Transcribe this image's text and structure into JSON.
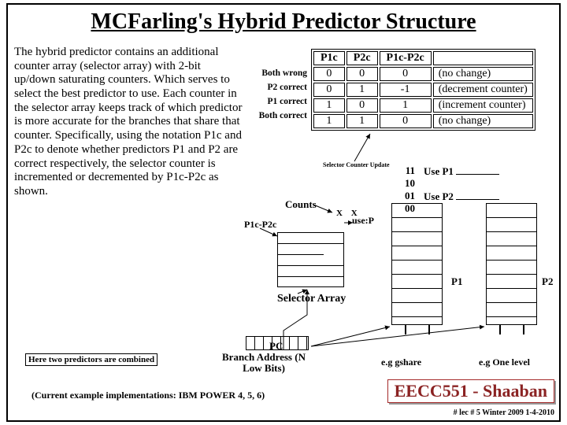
{
  "title": "MCFarling's Hybrid Predictor Structure",
  "body": "The hybrid predictor contains an additional counter array (selector array) with 2-bit up/down saturating counters. Which serves to select the best predictor to use. Each counter in the selector array keeps track of which predictor is more accurate for the branches that share that counter. Specifically, using the notation P1c and P2c to denote whether predictors P1 and P2 are correct respectively, the selector counter is incremented or decremented by P1c-P2c as shown.",
  "row_labels": [
    "Both wrong",
    "P2 correct",
    "P1 correct",
    "Both correct"
  ],
  "table": {
    "headers": [
      "P1c",
      "P2c",
      "P1c-P2c",
      ""
    ],
    "rows": [
      [
        "0",
        "0",
        "0",
        "(no change)"
      ],
      [
        "0",
        "1",
        "-1",
        "(decrement counter)"
      ],
      [
        "1",
        "0",
        "1",
        "(increment counter)"
      ],
      [
        "1",
        "1",
        "0",
        "(no change)"
      ]
    ]
  },
  "scu": "Selector Counter Update",
  "counts": "Counts",
  "xx": "X   X",
  "plcp2c": "P1c-P2c",
  "usep_label": "use:P",
  "states": [
    "11",
    "10",
    "01",
    "00"
  ],
  "use_p1": "Use P1",
  "use_p2": "Use P2",
  "sel_array": "Selector Array",
  "pc": "PC",
  "hint_left": "Here two predictors are combined",
  "branch_addr": "Branch Address (N Low Bits)",
  "eg_gshare": "e.g gshare",
  "eg_onelevel": "e.g One level",
  "impl": "(Current example implementations:  IBM POWER 4, 5, 6)",
  "course": "EECC551 - Shaaban",
  "lec": "#  lec # 5   Winter 2009   1-4-2010",
  "p1": "P1",
  "p2": "P2"
}
